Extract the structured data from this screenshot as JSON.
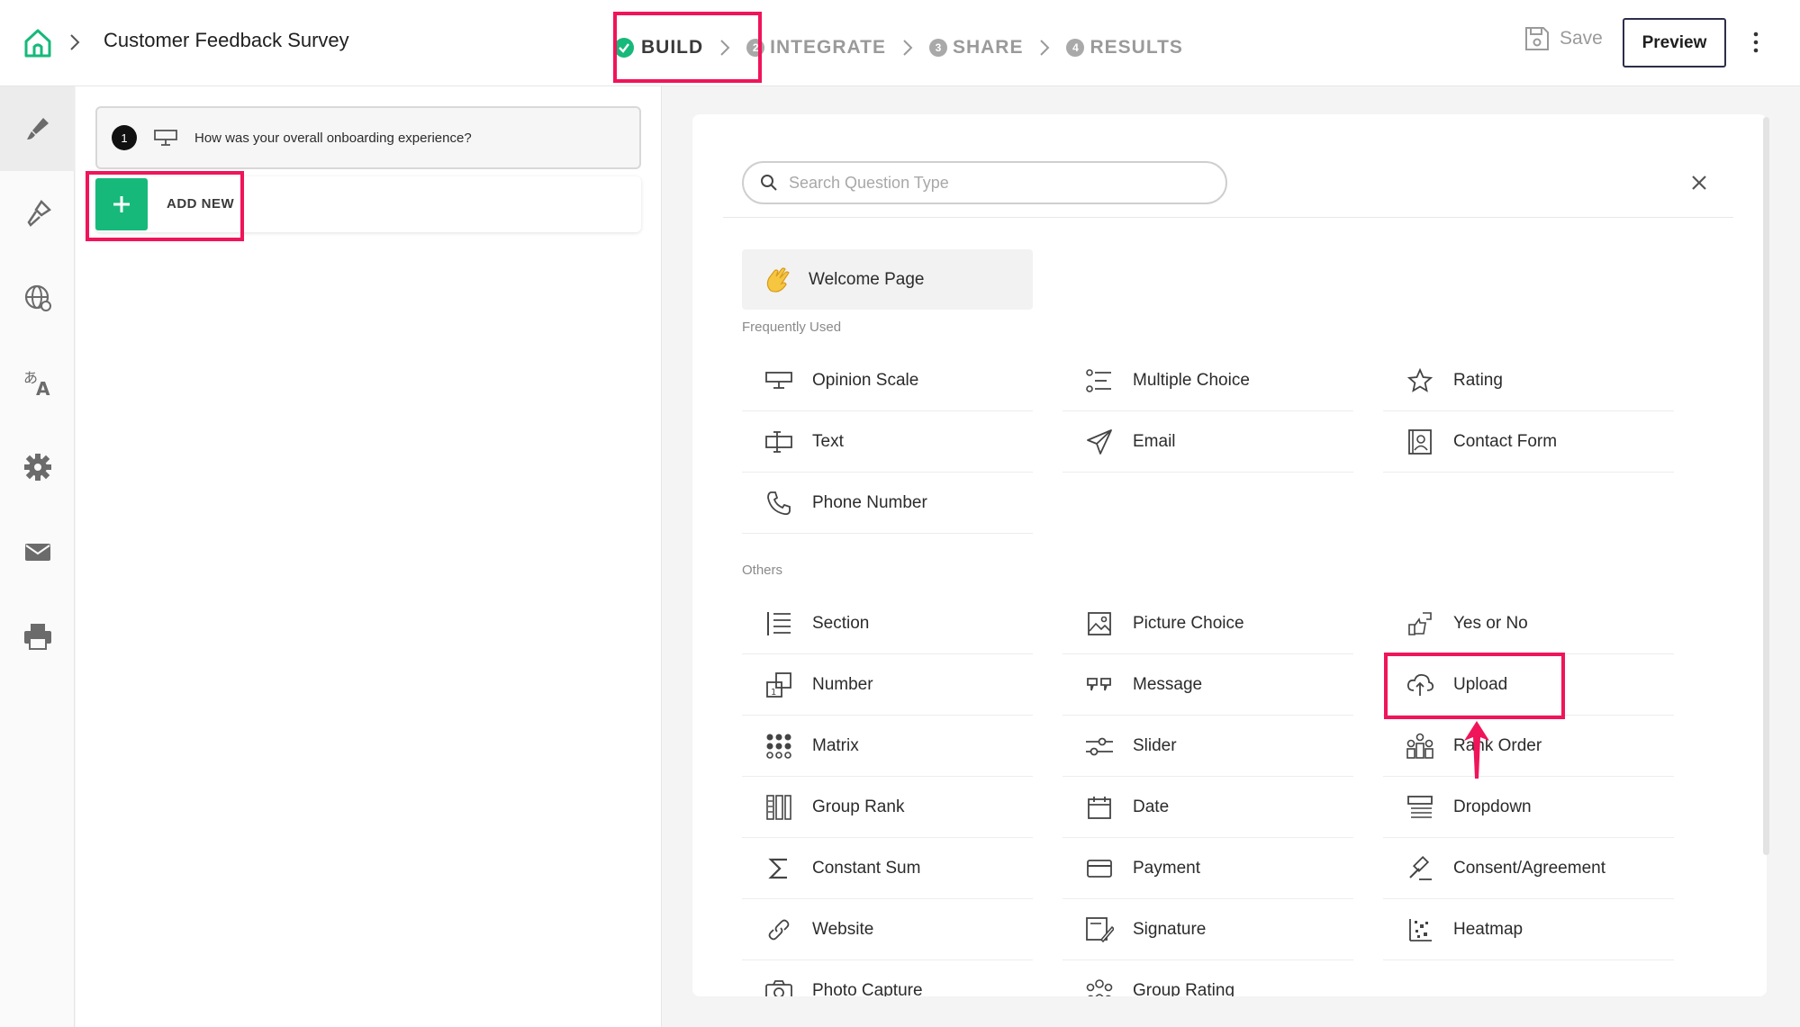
{
  "header": {
    "survey_title": "Customer Feedback Survey",
    "steps": [
      {
        "num": "",
        "label": "BUILD"
      },
      {
        "num": "2",
        "label": "INTEGRATE"
      },
      {
        "num": "3",
        "label": "SHARE"
      },
      {
        "num": "4",
        "label": "RESULTS"
      }
    ],
    "save_label": "Save",
    "preview_label": "Preview"
  },
  "rail": {
    "icons": [
      "brush-icon",
      "paint-roller-icon",
      "globe-icon",
      "translate-icon",
      "gear-icon",
      "mail-icon",
      "printer-icon"
    ]
  },
  "question_list": {
    "questions": [
      {
        "number": "1",
        "text": "How was your overall onboarding experience?"
      }
    ],
    "add_new_label": "ADD NEW"
  },
  "question_types": {
    "search_placeholder": "Search Question Type",
    "welcome_label": "Welcome Page",
    "frequently_used_label": "Frequently Used",
    "others_label": "Others",
    "frequently_used": [
      "Opinion Scale",
      "Multiple Choice",
      "Rating",
      "Text",
      "Email",
      "Contact Form",
      "Phone Number"
    ],
    "others": [
      "Section",
      "Picture Choice",
      "Yes or No",
      "Number",
      "Message",
      "Upload",
      "Matrix",
      "Slider",
      "Rank Order",
      "Group Rank",
      "Date",
      "Dropdown",
      "Constant Sum",
      "Payment",
      "Consent/Agreement",
      "Website",
      "Signature",
      "Heatmap",
      "Photo Capture",
      "Group Rating"
    ]
  },
  "colors": {
    "accent_green": "#16b97a",
    "highlight_pink": "#f0145a"
  }
}
